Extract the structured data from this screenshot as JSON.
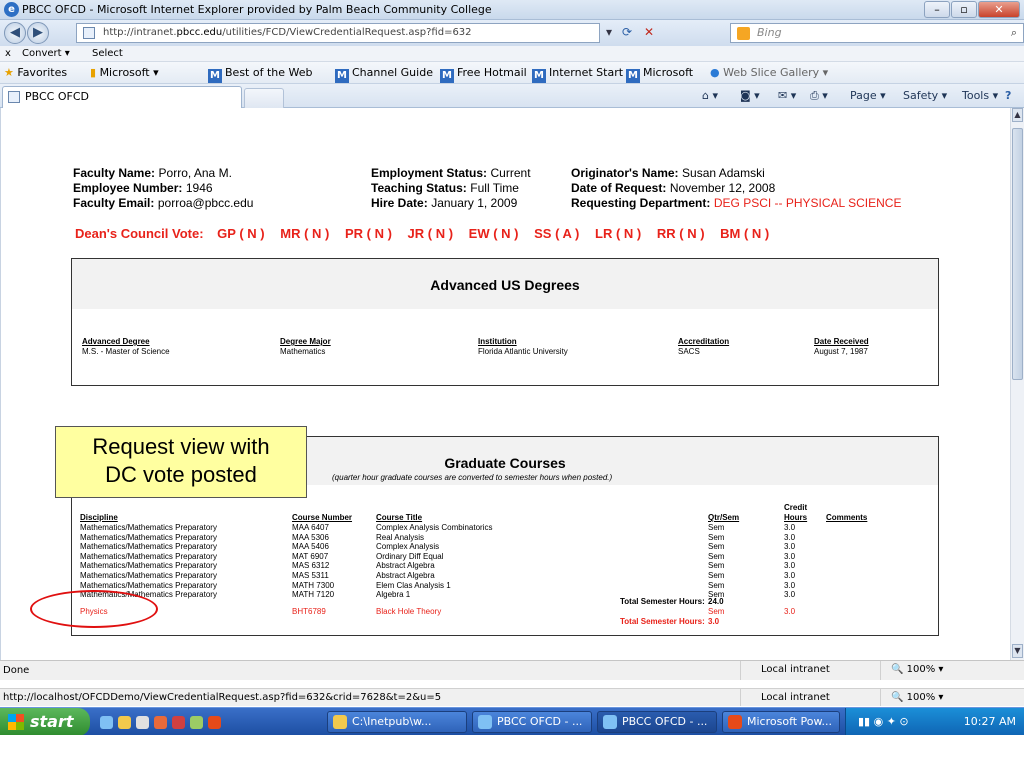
{
  "window": {
    "title": "PBCC OFCD - Microsoft Internet Explorer provided by Palm Beach Community College"
  },
  "address": {
    "prefix": "http://intranet.",
    "domain": "pbcc.edu",
    "path": "/utilities/FCD/ViewCredentialRequest.asp?fid=632"
  },
  "search": {
    "placeholder": "Bing"
  },
  "toolbar": {
    "convert": "Convert",
    "select": "Select"
  },
  "favorites": {
    "label": "Favorites",
    "items": [
      "Microsoft",
      "Best of the Web",
      "Channel Guide",
      "Free Hotmail",
      "Internet Start",
      "Microsoft",
      "Web Slice Gallery"
    ]
  },
  "tab": {
    "title": "PBCC OFCD"
  },
  "commands": {
    "page": "Page",
    "safety": "Safety",
    "tools": "Tools"
  },
  "faculty": {
    "name_label": "Faculty Name:",
    "name": "Porro, Ana M.",
    "empnum_label": "Employee Number:",
    "empnum": "1946",
    "email_label": "Faculty Email:",
    "email": "porroa@pbcc.edu",
    "emp_status_label": "Employment Status:",
    "emp_status": "Current",
    "teach_status_label": "Teaching Status:",
    "teach_status": "Full Time",
    "hire_label": "Hire Date:",
    "hire": "January 1, 2009",
    "orig_label": "Originator's Name:",
    "orig": "Susan Adamski",
    "date_req_label": "Date of Request:",
    "date_req": "November 12, 2008",
    "dept_label": "Requesting Department:",
    "dept": "DEG PSCI -- PHYSICAL SCIENCE"
  },
  "vote": {
    "label": "Dean's Council Vote:",
    "items": [
      "GP ( N )",
      "MR ( N )",
      "PR ( N )",
      "JR ( N )",
      "EW ( N )",
      "SS ( A )",
      "LR ( N )",
      "RR ( N )",
      "BM ( N )"
    ]
  },
  "degrees": {
    "title": "Advanced US Degrees",
    "headers": [
      "Advanced Degree",
      "Degree Major",
      "Institution",
      "Accreditation",
      "Date Received"
    ],
    "row": [
      "M.S. - Master of Science",
      "Mathematics",
      "Florida Atlantic University",
      "SACS",
      "August 7, 1987"
    ]
  },
  "courses": {
    "title": "Graduate Courses",
    "subtitle": "(quarter hour graduate courses are converted to semester hours when posted.)",
    "headers": [
      "Discipline",
      "Course Number",
      "Course Title",
      "Qtr/Sem",
      "Credit",
      "Hours",
      "Comments"
    ],
    "rows": [
      [
        "Mathematics/Mathematics Preparatory",
        "MAA 6407",
        "Complex Analysis Combinatorics",
        "Sem",
        "3.0"
      ],
      [
        "Mathematics/Mathematics Preparatory",
        "MAA 5306",
        "Real Analysis",
        "Sem",
        "3.0"
      ],
      [
        "Mathematics/Mathematics Preparatory",
        "MAA 5406",
        "Complex Analysis",
        "Sem",
        "3.0"
      ],
      [
        "Mathematics/Mathematics Preparatory",
        "MAT 6907",
        "Ordinary Diff Equal",
        "Sem",
        "3.0"
      ],
      [
        "Mathematics/Mathematics Preparatory",
        "MAS 6312",
        "Abstract Algebra",
        "Sem",
        "3.0"
      ],
      [
        "Mathematics/Mathematics Preparatory",
        "MAS 5311",
        "Abstract Algebra",
        "Sem",
        "3.0"
      ],
      [
        "Mathematics/Mathematics Preparatory",
        "MATH 7300",
        "Elem Clas Analysis 1",
        "Sem",
        "3.0"
      ],
      [
        "Mathematics/Mathematics Preparatory",
        "MATH 7120",
        "Algebra 1",
        "Sem",
        "3.0"
      ]
    ],
    "total1_label": "Total Semester Hours:",
    "total1": "24.0",
    "physics": [
      "Physics",
      "BHT6789",
      "Black Hole Theory",
      "Sem",
      "3.0"
    ],
    "total2_label": "Total Semester Hours:",
    "total2": "3.0"
  },
  "callout": {
    "line1": "Request view with",
    "line2": "DC vote posted"
  },
  "status": {
    "done": "Done",
    "zone": "Local intranet",
    "zoom": "100%"
  },
  "status2": {
    "url": "http://localhost/OFCDDemo/ViewCredentialRequest.asp?fid=632&crid=7628&t=2&u=5",
    "zone": "Local intranet",
    "zoom": "100%"
  },
  "taskbar": {
    "start": "start",
    "buttons": [
      "C:\\Inetpub\\w...",
      "PBCC OFCD - ...",
      "PBCC OFCD - ...",
      "Microsoft Pow..."
    ],
    "clock": "10:27 AM"
  },
  "colors": {
    "red": "#e8221a",
    "callout": "#ffffa0"
  }
}
